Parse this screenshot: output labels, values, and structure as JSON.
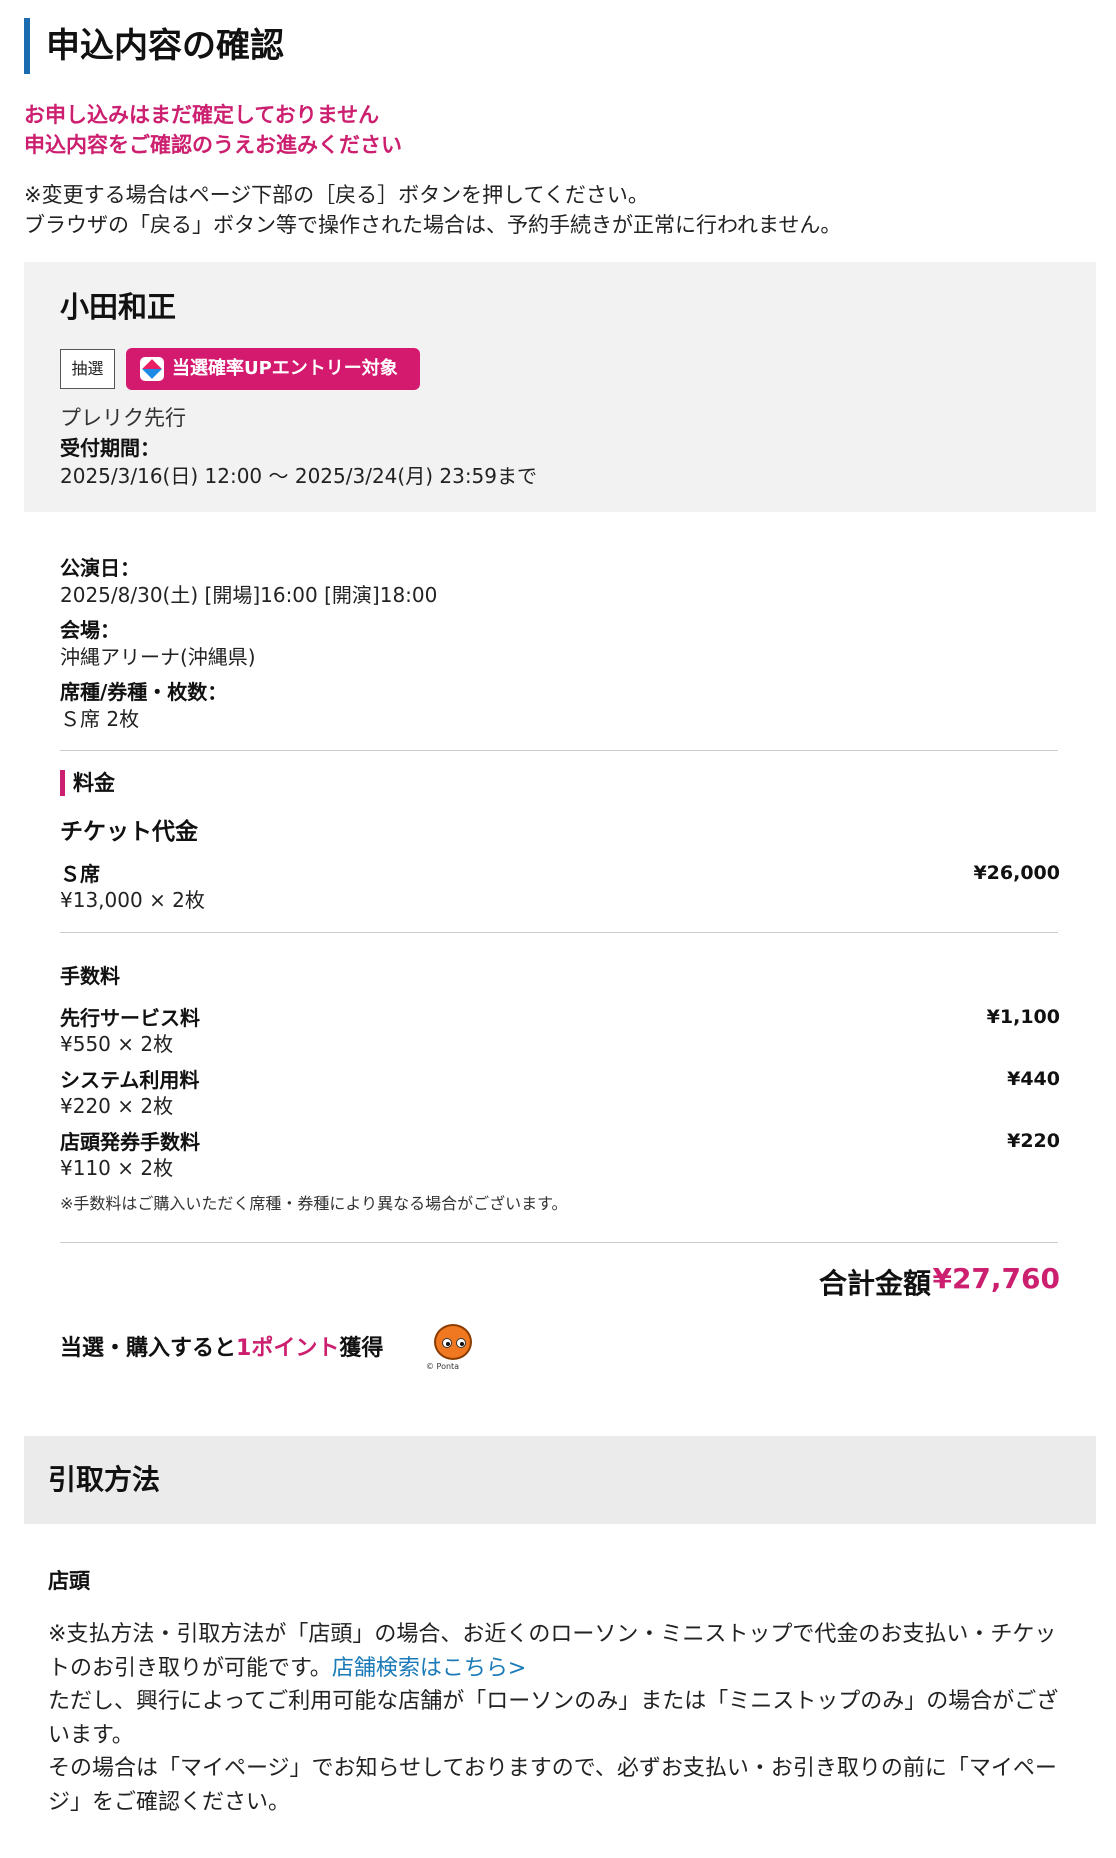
{
  "page_title": "申込内容の確認",
  "warning": {
    "line1": "お申し込みはまだ確定しておりません",
    "line2": "申込内容をご確認のうえお進みください"
  },
  "notice": {
    "line1": "※変更する場合はページ下部の［戻る］ボタンを押してください。",
    "line2": "ブラウザの「戻る」ボタン等で操作された場合は、予約手続きが正常に行われません。"
  },
  "performance": {
    "artist": "小田和正",
    "badge_lottery": "抽選",
    "badge_entry": "当選確率UPエントリー対象",
    "sale_name": "プレリク先行",
    "period_label": "受付期間：",
    "period_value": "2025/3/16(日) 12:00 〜 2025/3/24(月) 23:59まで"
  },
  "details": {
    "date_label": "公演日：",
    "date_value": "2025/8/30(土) [開場]16:00 [開演]18:00",
    "venue_label": "会場：",
    "venue_value": "沖縄アリーナ(沖縄県)",
    "seat_label": "席種/券種・枚数：",
    "seat_value": "Ｓ席 2枚"
  },
  "price": {
    "section_label": "料金",
    "ticket_heading": "チケット代金",
    "ticket": {
      "name": "Ｓ席",
      "unit": "¥13,000 × 2枚",
      "amount": "¥26,000"
    },
    "fee_heading": "手数料",
    "fees": [
      {
        "name": "先行サービス料",
        "unit": "¥550 × 2枚",
        "amount": "¥1,100"
      },
      {
        "name": "システム利用料",
        "unit": "¥220 × 2枚",
        "amount": "¥440"
      },
      {
        "name": "店頭発券手数料",
        "unit": "¥110 × 2枚",
        "amount": "¥220"
      }
    ],
    "fee_note": "※手数料はご購入いただく席種・券種により異なる場合がございます。",
    "total_label": "合計金額",
    "total_value": "¥27,760"
  },
  "points": {
    "prefix": "当選・購入すると",
    "point": "1ポイント",
    "suffix": "獲得",
    "ponta_copy": "© Ponta"
  },
  "pickup": {
    "title": "引取方法",
    "store_label": "店頭",
    "text1": "※支払方法・引取方法が「店頭」の場合、お近くのローソン・ミニストップで代金のお支払い・チケットのお引き取りが可能です。",
    "link": "店舗検索はこちら>",
    "text2": "ただし、興行によってご利用可能な店舗が「ローソンのみ」または「ミニストップのみ」の場合がございます。",
    "text3": "その場合は「マイページ」でお知らせしておりますので、必ずお支払い・お引き取りの前に「マイページ」をご確認ください。"
  }
}
